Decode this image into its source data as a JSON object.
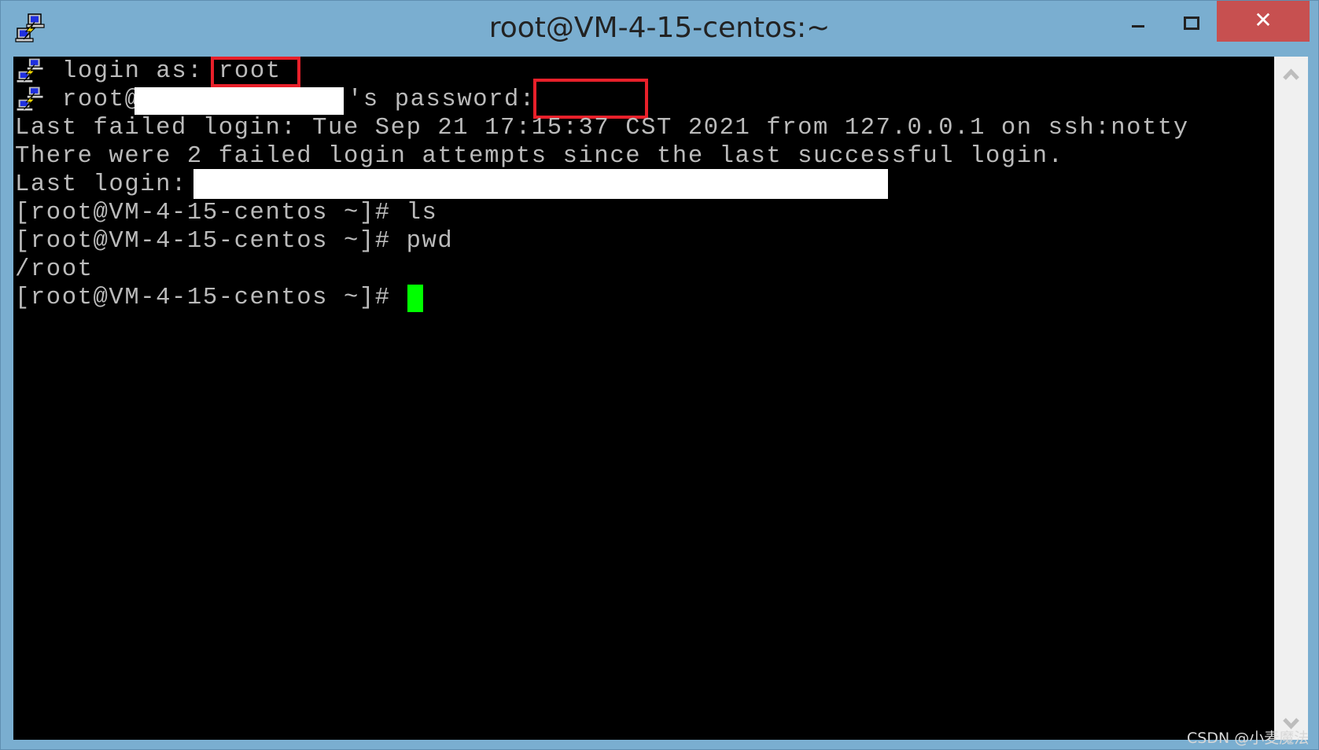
{
  "window": {
    "title": "root@VM-4-15-centos:~",
    "app_icon": "putty-icon",
    "controls": {
      "minimize": "minimize",
      "maximize": "maximize",
      "close": "✕"
    }
  },
  "terminal": {
    "lines": [
      {
        "prefix_icon": "putty-icon",
        "text": "login as: ",
        "input": "root"
      },
      {
        "prefix_icon": "putty-icon",
        "text_before": "root@",
        "redacted": true,
        "text_after": "'s password:"
      },
      {
        "text": "Last failed login: Tue Sep 21 17:15:37 CST 2021 from 127.0.0.1 on ssh:notty"
      },
      {
        "text": "There were 2 failed login attempts since the last successful login."
      },
      {
        "text": "Last login: ",
        "redacted": true
      },
      {
        "text": "[root@VM-4-15-centos ~]# ls"
      },
      {
        "text": "[root@VM-4-15-centos ~]# pwd"
      },
      {
        "text": "/root"
      },
      {
        "text": "[root@VM-4-15-centos ~]# "
      }
    ],
    "cursor_color": "#00ff00",
    "text_color": "#bbbbbb",
    "highlight_color": "#e8202a"
  },
  "scrollbar": {
    "up": "▲",
    "down": "▼"
  },
  "watermark": "CSDN @小麦魔法"
}
